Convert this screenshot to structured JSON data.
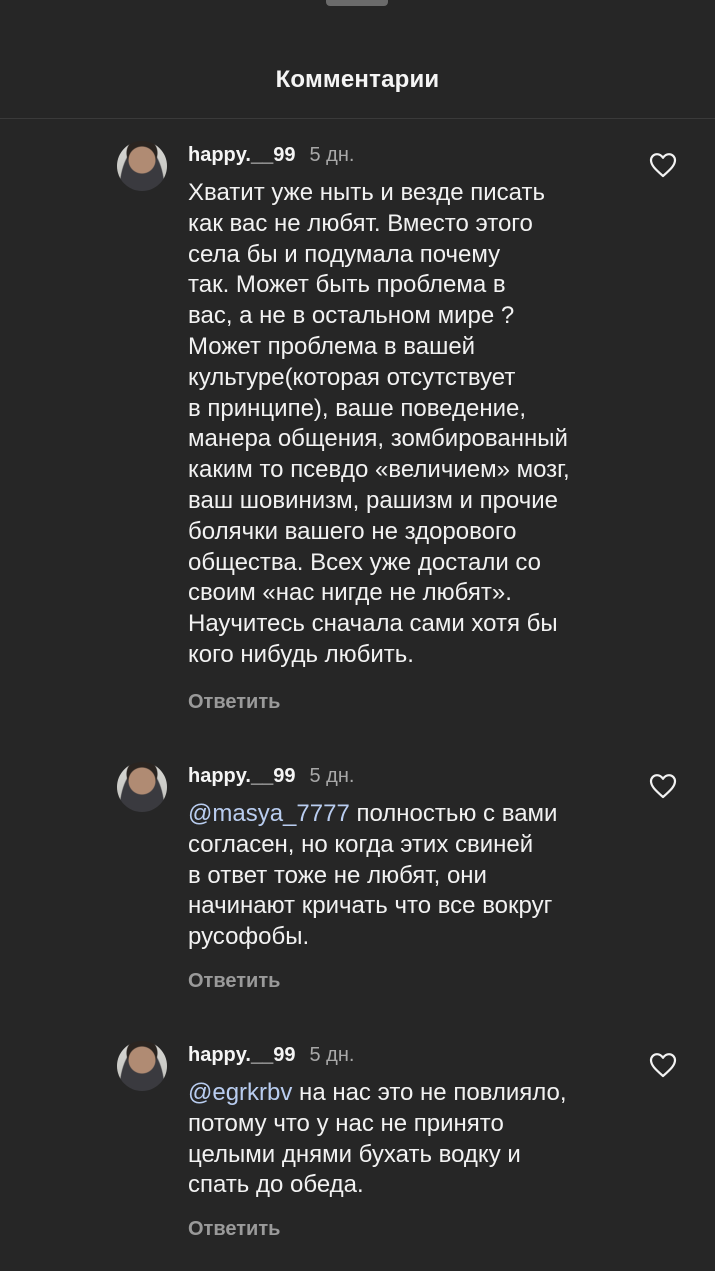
{
  "header": {
    "title": "Комментарии"
  },
  "comments": [
    {
      "username": "happy.__99",
      "time": "5 дн.",
      "mention": "",
      "text": "Хватит уже ныть и везде писать\nкак вас не любят. Вместо этого\nсела бы и подумала почему\nтак. Может быть проблема в\nвас, а не в остальном мире ?\nМожет проблема в вашей\nкультуре(которая отсутствует\nв принципе), ваше поведение,\nманера общения, зомбированный\nкаким то псевдо «величием» мозг,\nваш шовинизм, рашизм и прочие\nболячки вашего не здорового\nобщества. Всех уже достали со\nсвоим «нас нигде не любят».\nНаучитесь сначала сами хотя бы\nкого нибудь любить.",
      "reply_label": "Ответить",
      "like_icon": "heart-outline-icon"
    },
    {
      "username": "happy.__99",
      "time": "5 дн.",
      "mention": "@masya_7777",
      "text": " полностью с вами\nсогласен, но когда этих свиней\nв ответ тоже не любят, они\nначинают кричать что все вокруг\nрусофобы.",
      "reply_label": "Ответить",
      "like_icon": "heart-outline-icon"
    },
    {
      "username": "happy.__99",
      "time": "5 дн.",
      "mention": "@egrkrbv",
      "text": " на нас это не повлияло,\nпотому что у нас не принято\nцелыми днями бухать водку и\nспать до обеда.",
      "reply_label": "Ответить",
      "like_icon": "heart-outline-icon"
    }
  ]
}
